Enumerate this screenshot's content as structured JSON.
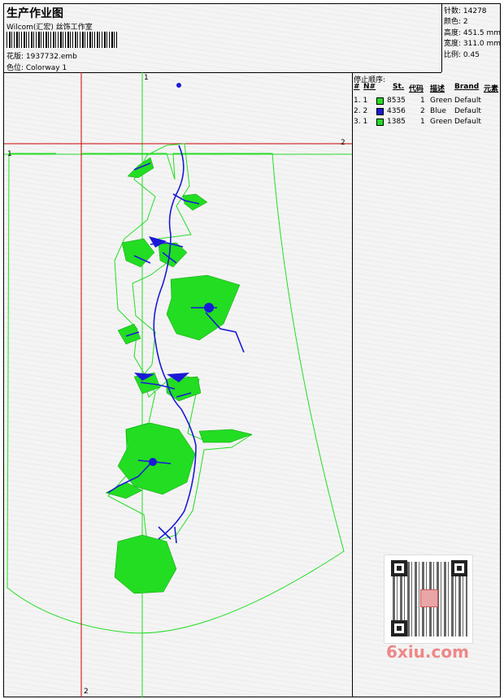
{
  "header": {
    "title": "生产作业图",
    "subtitle": "Wilcom(汇宏) 丝饰工作室",
    "design_line": "花版: 1937732.emb",
    "colorway_line": "色位: Colorway 1"
  },
  "info": {
    "stitches": "针数: 14278",
    "colors": "颜色: 2",
    "height": "高度: 451.5 mm",
    "width": "宽度: 311.0 mm",
    "scale": "比例: 0.45"
  },
  "stop_sequence": {
    "title": "停止顺序:",
    "headers": {
      "hash": "#",
      "n": "N#",
      "st": "St.",
      "code": "代码",
      "desc": "描述",
      "brand": "Brand",
      "element": "元素"
    },
    "rows": [
      {
        "idx": "1. 1",
        "color": "#22dd22",
        "st": "8535",
        "code": "1",
        "desc": "Green",
        "brand": "Default"
      },
      {
        "idx": "2. 2",
        "color": "#1a1ad6",
        "st": "4356",
        "code": "2",
        "desc": "Blue",
        "brand": "Default"
      },
      {
        "idx": "3. 1",
        "color": "#22dd22",
        "st": "1385",
        "code": "1",
        "desc": "Green",
        "brand": "Default"
      }
    ]
  },
  "guides": {
    "v_green_label": "1",
    "h_green_label": "1",
    "h_red_label": "2",
    "v_red_label": "2"
  },
  "watermark": {
    "text": "6xiu.com"
  },
  "colors": {
    "green": "#22dd22",
    "blue": "#1a1ad6",
    "red": "#cc0000"
  }
}
